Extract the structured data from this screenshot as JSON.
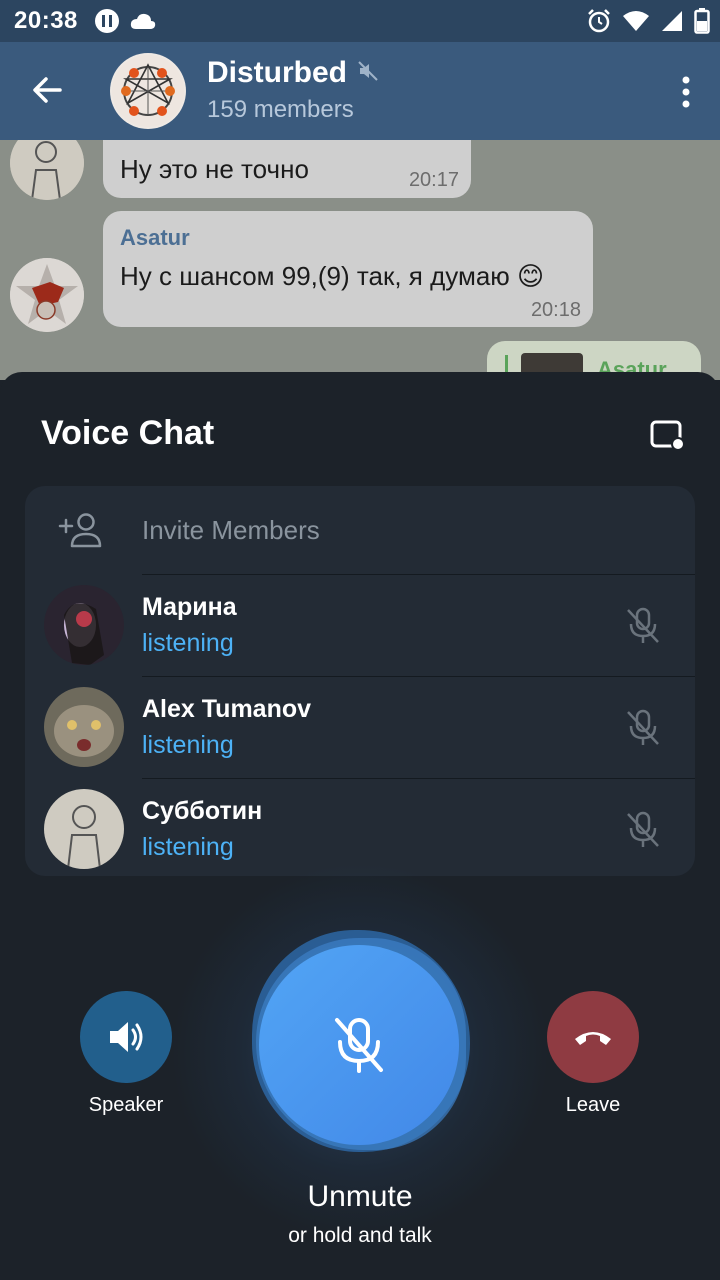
{
  "status_bar": {
    "time": "20:38",
    "icons": [
      "pause-circle-icon",
      "cloud-icon",
      "alarm-icon",
      "wifi-icon",
      "signal-icon",
      "battery-icon"
    ]
  },
  "header": {
    "title": "Disturbed",
    "subtitle": "159 members",
    "muted_icon": "muted-speaker-icon"
  },
  "chat": {
    "messages": [
      {
        "text": "Ну это не точно",
        "time": "20:17"
      },
      {
        "sender": "Asatur",
        "text": "Ну с шансом 99,(9) так, я думаю 😊",
        "time": "20:18"
      },
      {
        "sender": "Asatur"
      }
    ]
  },
  "voice_chat": {
    "title": "Voice Chat",
    "invite_label": "Invite Members",
    "members": [
      {
        "name": "Марина",
        "status": "listening"
      },
      {
        "name": "Alex Tumanov",
        "status": "listening"
      },
      {
        "name": "Субботин",
        "status": "listening"
      }
    ],
    "controls": {
      "speaker_label": "Speaker",
      "leave_label": "Leave",
      "unmute_label": "Unmute",
      "hint_label": "or hold and talk"
    }
  },
  "colors": {
    "accent_blue": "#4db2f6",
    "header_bg": "#3a5a7d",
    "sheet_bg": "#1c2229",
    "leave_red": "#8f3b42",
    "speaker_blue": "#225f8c"
  }
}
